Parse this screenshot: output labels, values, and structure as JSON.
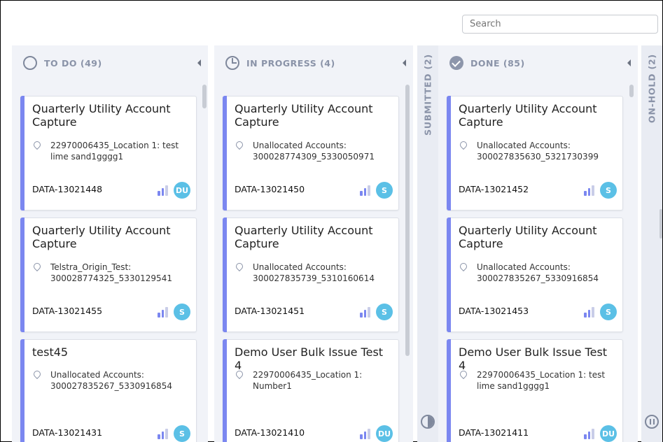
{
  "search": {
    "placeholder": "Search"
  },
  "columns": [
    {
      "title": "TO DO (49)",
      "icon": "circle-icon",
      "cards": [
        {
          "title": "Quarterly Utility Account Capture",
          "location": "22970006435_Location 1: test lime sand1gggg1",
          "id": "DATA-13021448",
          "assignee": "DU"
        },
        {
          "title": "Quarterly Utility Account Capture",
          "location": "Telstra_Origin_Test: 300028774325_5330129541",
          "id": "DATA-13021455",
          "assignee": "S"
        },
        {
          "title": "test45",
          "location": "Unallocated Accounts: 300027835267_5330916854",
          "id": "DATA-13021431",
          "assignee": "S"
        }
      ]
    },
    {
      "title": "IN PROGRESS (4)",
      "icon": "progress-icon",
      "cards": [
        {
          "title": "Quarterly Utility Account Capture",
          "location": "Unallocated Accounts: 300028774309_5330050971",
          "id": "DATA-13021450",
          "assignee": "S"
        },
        {
          "title": "Quarterly Utility Account Capture",
          "location": "Unallocated Accounts: 300027835739_5310160614",
          "id": "DATA-13021451",
          "assignee": "S"
        },
        {
          "title": "Demo User Bulk Issue Test 4",
          "location": "22970006435_Location 1: Number1",
          "id": "DATA-13021410",
          "assignee": "DU"
        }
      ]
    },
    {
      "title": "DONE (85)",
      "icon": "check-circle-icon",
      "cards": [
        {
          "title": "Quarterly Utility Account Capture",
          "location": "Unallocated Accounts: 300027835630_5321730399",
          "id": "DATA-13021452",
          "assignee": "S"
        },
        {
          "title": "Quarterly Utility Account Capture",
          "location": "Unallocated Accounts: 300027835267_5330916854",
          "id": "DATA-13021453",
          "assignee": "S"
        },
        {
          "title": "Demo User Bulk Issue Test 4",
          "location": "22970006435_Location 1: test lime sand1gggg1",
          "id": "DATA-13021411",
          "assignee": "DU"
        }
      ]
    }
  ],
  "collapsed_columns": [
    {
      "title": "SUBMITTED (2)",
      "icon": "half-circle-icon"
    },
    {
      "title": "ON-HOLD (2)",
      "icon": "pause-circle-icon"
    }
  ],
  "colors": {
    "accent_bar": "#7b87f0",
    "avatar": "#5bc0e6",
    "column_bg": "#f1f3f8"
  }
}
